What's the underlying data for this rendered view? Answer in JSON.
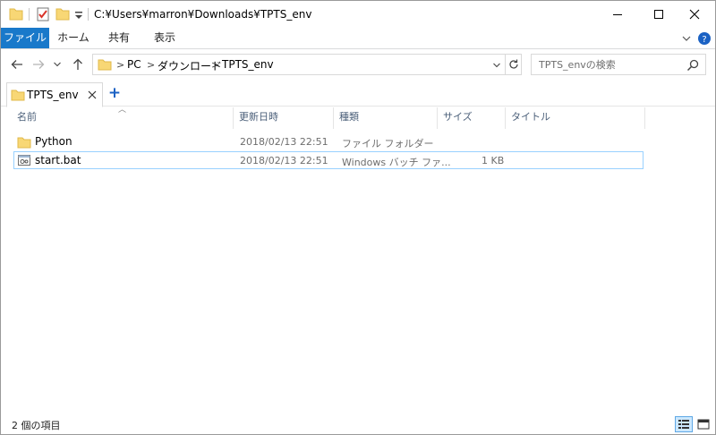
{
  "window": {
    "path_title": "C:¥Users¥marron¥Downloads¥TPTS_env"
  },
  "ribbon": {
    "tabs": [
      "ファイル",
      "ホーム",
      "共有",
      "表示"
    ]
  },
  "address": {
    "crumbs": [
      "PC",
      "ダウンロード",
      "TPTS_env"
    ]
  },
  "search": {
    "placeholder": "TPTS_envの検索"
  },
  "doc_tab": {
    "label": "TPTS_env",
    "new_tab": "+"
  },
  "columns": {
    "name": "名前",
    "date": "更新日時",
    "type": "種類",
    "size": "サイズ",
    "title": "タイトル"
  },
  "files": [
    {
      "name": "Python",
      "date": "2018/02/13 22:51",
      "type": "ファイル フォルダー",
      "size": "",
      "icon": "folder-icon"
    },
    {
      "name": "start.bat",
      "date": "2018/02/13 22:51",
      "type": "Windows バッチ ファ...",
      "size": "1 KB",
      "icon": "batch-file-icon"
    }
  ],
  "status": {
    "item_count": "2 個の項目"
  },
  "colors": {
    "accent": "#1979ca",
    "folder": "#f8d775",
    "selection_border": "#99d1ff"
  }
}
